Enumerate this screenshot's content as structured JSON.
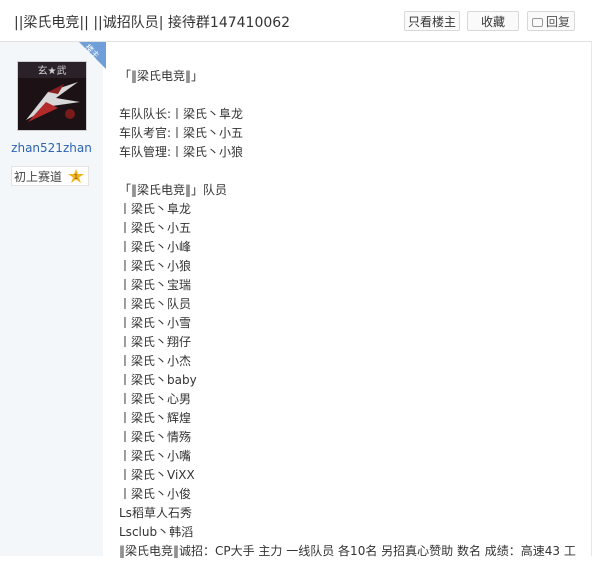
{
  "header": {
    "title": "||梁氏电竞|| ||诚招队员| 接待群147410062",
    "only_op_label": "只看楼主",
    "favorite_label": "收藏",
    "reply_label": "回复"
  },
  "author": {
    "badge": "楼主",
    "avatar_text": "玄★武",
    "name": "zhan521zhan",
    "level_title": "初上赛道",
    "level_number": "1"
  },
  "post": {
    "lines": [
      "「‖梁氏电竞‖」",
      "",
      "车队队长:丨梁氏丶阜龙",
      "车队考官:丨梁氏丶小五",
      "车队管理:丨梁氏丶小狼",
      "",
      "「‖梁氏电竞‖」队员",
      "丨梁氏丶阜龙",
      "丨梁氏丶小五",
      "丨梁氏丶小峰",
      "丨梁氏丶小狼",
      "丨梁氏丶宝瑞",
      "丨梁氏丶队员",
      "丨梁氏丶小雪",
      "丨梁氏丶翔仔",
      "丨梁氏丶小杰",
      "丨梁氏丶baby",
      "丨梁氏丶心男",
      "丨梁氏丶辉煌",
      "丨梁氏丶情殇",
      "丨梁氏丶小嘴",
      "丨梁氏丶ViXX",
      "丨梁氏丶小俊",
      "Ls稻草人石秀",
      "Lsclub丶韩滔",
      "‖梁氏电竞‖诚招：CP大手 主力 一线队员 各10名 另招真心赞助 数名 成绩：高速43 工"
    ]
  }
}
